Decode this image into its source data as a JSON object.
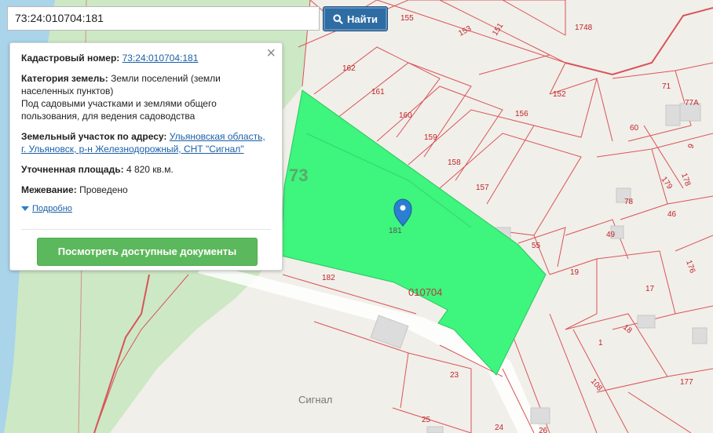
{
  "search": {
    "value": "73:24:010704:181",
    "button_label": "Найти"
  },
  "panel": {
    "cadastral_label": "Кадастровый номер:",
    "cadastral_value": "73:24:010704:181",
    "category_label": "Категория земель:",
    "category_value": "Земли поселений (земли населенных пунктов)",
    "usage_value": "Под садовыми участками и землями общего пользования, для ведения садоводства",
    "address_label": "Земельный участок по адресу:",
    "address_value": "Ульяновская область, г. Ульяновск, р-н Железнодорожный, СНТ \"Сигнал\"",
    "area_label": "Уточненная площадь:",
    "area_value": "4 820 кв.м.",
    "survey_label": "Межевание:",
    "survey_value": "Проведено",
    "more_label": "Подробно",
    "docs_button": "Посмотреть доступные документы"
  },
  "map": {
    "district_label": "73",
    "quarter_label": "010704",
    "selected_plot_label": "181",
    "place_label": "Сигнал",
    "plot_labels": [
      "155",
      "153",
      "151",
      "1748",
      "162",
      "161",
      "160",
      "159",
      "158",
      "157",
      "152",
      "156",
      "71",
      "77А",
      "60",
      "9",
      "179",
      "178",
      "78",
      "46",
      "49",
      "176",
      "55",
      "19",
      "17",
      "182",
      "18",
      "1",
      "108",
      "177",
      "23",
      "25",
      "24",
      "26"
    ],
    "colors": {
      "selected_plot": "#3ef57d",
      "boundary": "#d9535a",
      "water": "#a9d4ea",
      "park": "#cde8c4",
      "button": "#5cb85c",
      "search_button": "#2e6da4"
    }
  }
}
